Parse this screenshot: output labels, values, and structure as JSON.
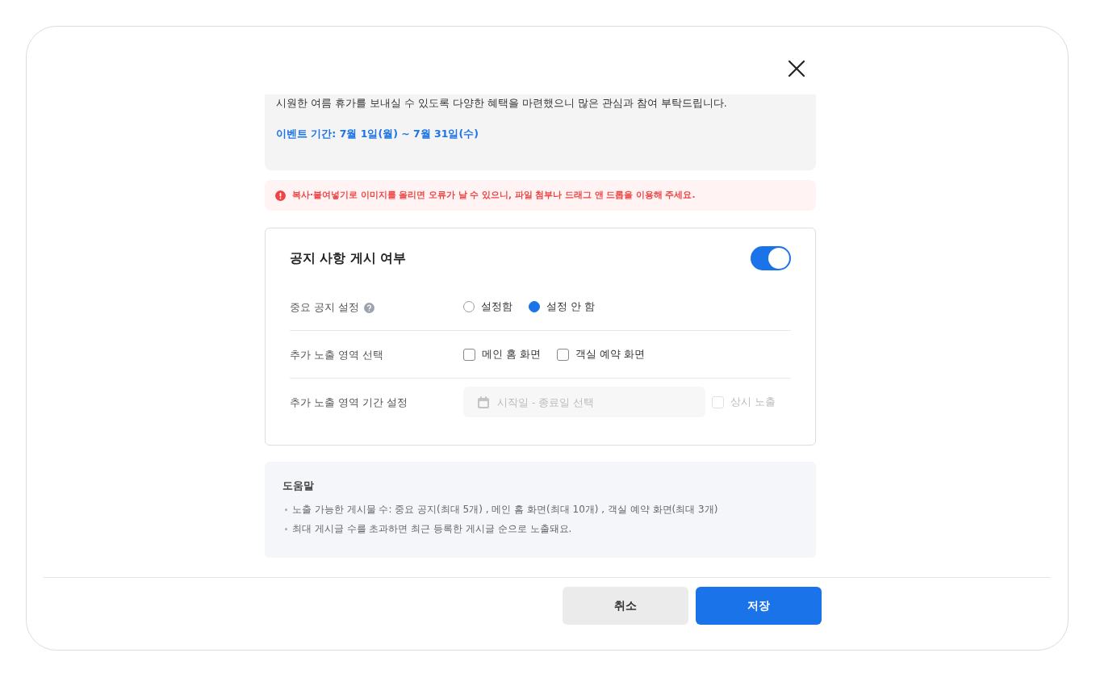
{
  "content_box": {
    "body": "시원한 여름 휴가를 보내실 수 있도록 다양한 혜택을 마련했으니 많은 관심과 참여 부탁드립니다.",
    "event_period": "이벤트 기간: 7월 1일(월) ~ 7월 31일(수)"
  },
  "warning": "복사·붙여넣기로 이미지를 올리면 오류가 날 수 있으니, 파일 첨부나 드래그 앤 드롭을 이용해 주세요.",
  "settings": {
    "title": "공지 사항 게시 여부",
    "on": true,
    "rows": [
      {
        "kind": "radio",
        "label": "중요 공지 설정",
        "help": true,
        "options": [
          {
            "label": "설정함",
            "selected": false
          },
          {
            "label": "설정 안 함",
            "selected": true
          }
        ]
      },
      {
        "kind": "checkbox",
        "label": "추가 노출 영역 선택",
        "help": false,
        "options": [
          {
            "label": "메인 홈 화면",
            "checked": false
          },
          {
            "label": "객실 예약 화면",
            "checked": false
          }
        ]
      },
      {
        "kind": "daterange",
        "label": "추가 노출 영역 기간 설정",
        "help": false,
        "placeholder": "시작일 - 종료일 선택",
        "option": {
          "label": "상시 노출",
          "checked": false,
          "disabled": true
        }
      }
    ]
  },
  "help": {
    "title": "도움말",
    "items": [
      "노출 가능한 게시물 수: 중요 공지(최대 5개) , 메인 홈 화면(최대 10개) , 객실 예약 화면(최대 3개)",
      "최대 게시글 수를 초과하면 최근 등록한 게시글 순으로 노출돼요."
    ]
  },
  "buttons": [
    {
      "label": "취소",
      "kind": "secondary"
    },
    {
      "label": "저장",
      "kind": "primary"
    }
  ]
}
